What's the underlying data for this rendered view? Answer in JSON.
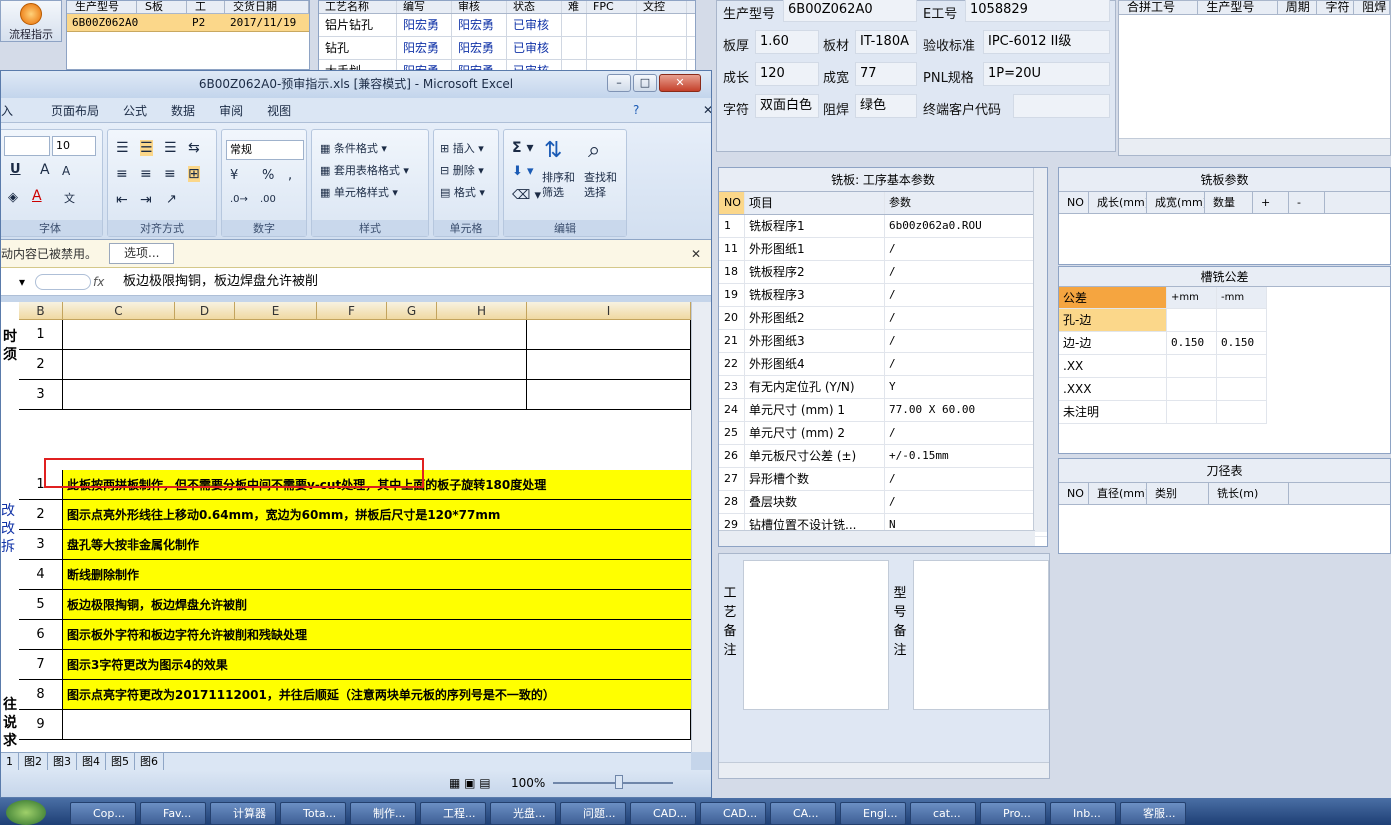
{
  "flow": {
    "label": "流程指示"
  },
  "order_grid": {
    "headers": [
      "生产型号",
      "S板",
      "工",
      "交货日期"
    ],
    "row": [
      "6B00Z062A0",
      "",
      "P2",
      "2017/11/19"
    ]
  },
  "process_grid": {
    "headers": [
      "工艺名称",
      "编写",
      "审核",
      "状态",
      "难",
      "FPC",
      "文控"
    ],
    "rows": [
      [
        "铝片钻孔",
        "阳宏勇",
        "阳宏勇",
        "已审核"
      ],
      [
        "钻孔",
        "阳宏勇",
        "阳宏勇",
        "已审核"
      ],
      [
        "大手划",
        "阳宏勇",
        "阳宏勇",
        "已审核"
      ]
    ]
  },
  "info": {
    "model_label": "生产型号",
    "model": "6B00Z062A0",
    "e_label": "E工号",
    "e": "1058829",
    "thick_label": "板厚",
    "thick": "1.60",
    "mat_label": "板材",
    "mat": "IT-180A",
    "std_label": "验收标准",
    "std": "IPC-6012 II级",
    "len_label": "成长",
    "len": "120",
    "wid_label": "成宽",
    "wid": "77",
    "pnl_label": "PNL规格",
    "pnl": "1P=20U",
    "char_label": "字符",
    "char": "双面白色",
    "mask_label": "阻焊",
    "mask": "绿色",
    "cust_label": "终端客户代码",
    "cust": ""
  },
  "merge_grid": {
    "headers": [
      "合拼工号",
      "生产型号",
      "周期",
      "字符",
      "阻焊"
    ]
  },
  "mill": {
    "title": "铣板: 工序基本参数",
    "headers": [
      "NO",
      "项目",
      "参数"
    ],
    "rows": [
      [
        "1",
        "铣板程序1",
        "6b00z062a0.ROU"
      ],
      [
        "11",
        "外形图纸1",
        "/"
      ],
      [
        "18",
        "铣板程序2",
        "/"
      ],
      [
        "19",
        "铣板程序3",
        "/"
      ],
      [
        "20",
        "外形图纸2",
        "/"
      ],
      [
        "21",
        "外形图纸3",
        "/"
      ],
      [
        "22",
        "外形图纸4",
        "/"
      ],
      [
        "23",
        "有无内定位孔 (Y/N)",
        "Y"
      ],
      [
        "24",
        "单元尺寸 (mm) 1",
        "77.00 X 60.00"
      ],
      [
        "25",
        "单元尺寸 (mm) 2",
        "/"
      ],
      [
        "26",
        "单元板尺寸公差 (±)",
        "+/-0.15mm"
      ],
      [
        "27",
        "异形槽个数",
        "/"
      ],
      [
        "28",
        "叠层块数",
        "/"
      ],
      [
        "29",
        "钻槽位置不设计铣...",
        "N"
      ]
    ]
  },
  "board_params": {
    "title": "铣板参数",
    "headers": [
      "NO",
      "成长(mm)",
      "成宽(mm)",
      "数量",
      "+",
      "-"
    ]
  },
  "tolerance": {
    "title": "槽铣公差",
    "headers": [
      "公差",
      "+mm",
      "-mm"
    ],
    "rows": [
      [
        "孔-边",
        "",
        ""
      ],
      [
        "边-边",
        "0.150",
        "0.150"
      ],
      [
        ".XX",
        "",
        ""
      ],
      [
        ".XXX",
        "",
        ""
      ],
      [
        "未注明",
        "",
        ""
      ]
    ]
  },
  "tools": {
    "title": "刀径表",
    "headers": [
      "NO",
      "直径(mm)",
      "类别",
      "铣长(m)"
    ]
  },
  "notes": {
    "process_label": "工艺备注",
    "model_label": "型号备注"
  },
  "excel": {
    "title": "6B00Z062A0-预审指示.xls [兼容模式] - Microsoft Excel",
    "menus": [
      "入",
      "页面布局",
      "公式",
      "数据",
      "审阅",
      "视图"
    ],
    "font_size": "10",
    "number_format": "常规",
    "groups": [
      "字体",
      "对齐方式",
      "数字",
      "样式",
      "单元格",
      "编辑"
    ],
    "style_buttons": [
      "条件格式",
      "套用表格格式",
      "单元格样式"
    ],
    "cell_buttons": [
      "插入",
      "删除",
      "格式"
    ],
    "edit_buttons": [
      "排序和筛选",
      "查找和选择"
    ],
    "msg": "动内容已被禁用。",
    "options": "选项...",
    "formula": "板边极限掏铜，板边焊盘允许被削",
    "columns": [
      "B",
      "C",
      "D",
      "E",
      "F",
      "G",
      "H",
      "I"
    ],
    "rows": [
      {
        "n": "1",
        "text": ""
      },
      {
        "n": "2",
        "text": ""
      },
      {
        "n": "3",
        "text": ""
      },
      {
        "n": "1",
        "text": "此板按两拼板制作，但不需要分板中间不需要v-cut处理，其中上面的板子旋转180度处理"
      },
      {
        "n": "2",
        "text": "图示点亮外形线往上移动0.64mm，宽边为60mm，拼板后尺寸是120*77mm"
      },
      {
        "n": "3",
        "text": "盘孔等大按非金属化制作"
      },
      {
        "n": "4",
        "text": "断线删除制作"
      },
      {
        "n": "5",
        "text": "板边极限掏铜，板边焊盘允许被削"
      },
      {
        "n": "6",
        "text": "图示板外字符和板边字符允许被削和残缺处理"
      },
      {
        "n": "7",
        "text": "图示3字符更改为图示4的效果"
      },
      {
        "n": "8",
        "text": "图示点亮字符更改为20171112001，并往后顺延（注意两块单元板的序列号是不一致的）"
      },
      {
        "n": "9",
        "text": ""
      }
    ],
    "side_chars_a": "时须",
    "side_chars_b": "改 改 拆",
    "side_chars_c": "往说求",
    "sheet_tabs": [
      "1",
      "图2",
      "图3",
      "图4",
      "图5",
      "图6"
    ],
    "zoom": "100%"
  },
  "taskbar": [
    "Cop...",
    "Fav...",
    "计算器",
    "Tota...",
    "制作...",
    "工程...",
    "光盘...",
    "问题...",
    "CAD...",
    "CAD...",
    "CA...",
    "Engi...",
    "cat...",
    "Pro...",
    "Inb...",
    "客服..."
  ]
}
